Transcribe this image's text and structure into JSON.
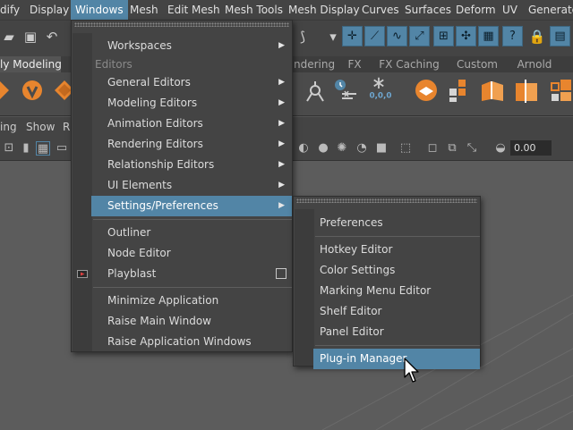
{
  "menubar": {
    "items": [
      "dify",
      "Display",
      "Windows",
      "Mesh",
      "Edit Mesh",
      "Mesh Tools",
      "Mesh Display",
      "Curves",
      "Surfaces",
      "Deform",
      "UV",
      "Generate"
    ],
    "active": "Windows"
  },
  "status_line": {
    "mode_label": "ly Modeling"
  },
  "shelf_tabs": [
    "ly Modeling",
    "ndering",
    "FX",
    "FX Caching",
    "Custom",
    "Arnold"
  ],
  "panel_menus": [
    "ing",
    "Show",
    "R"
  ],
  "panel_toolbar": {
    "exposure_value": "0.00"
  },
  "windows_menu": {
    "items": [
      {
        "label": "Workspaces",
        "submenu": true
      },
      {
        "label": "General Editors",
        "submenu": true
      },
      {
        "label": "Modeling Editors",
        "submenu": true
      },
      {
        "label": "Animation Editors",
        "submenu": true
      },
      {
        "label": "Rendering Editors",
        "submenu": true
      },
      {
        "label": "Relationship Editors",
        "submenu": true
      },
      {
        "label": "UI Elements",
        "submenu": true
      },
      {
        "label": "Settings/Preferences",
        "submenu": true,
        "highlighted": true
      },
      {
        "label": "Outliner"
      },
      {
        "label": "Node Editor"
      },
      {
        "label": "Playblast",
        "option_box": true
      },
      {
        "label": "Minimize Application"
      },
      {
        "label": "Raise Main Window"
      },
      {
        "label": "Raise Application Windows"
      }
    ],
    "section_label": "Editors"
  },
  "settings_submenu": {
    "items": [
      {
        "label": "Preferences"
      },
      {
        "label": "Hotkey Editor"
      },
      {
        "label": "Color Settings"
      },
      {
        "label": "Marking Menu Editor"
      },
      {
        "label": "Shelf Editor"
      },
      {
        "label": "Panel Editor"
      },
      {
        "label": "Plug-in Manager",
        "highlighted": true
      }
    ]
  },
  "colors": {
    "highlight": "#5285a6",
    "menu_bg": "#444444",
    "shelf_orange": "#e8852e",
    "viewport_bg": "#5c5c5c"
  }
}
